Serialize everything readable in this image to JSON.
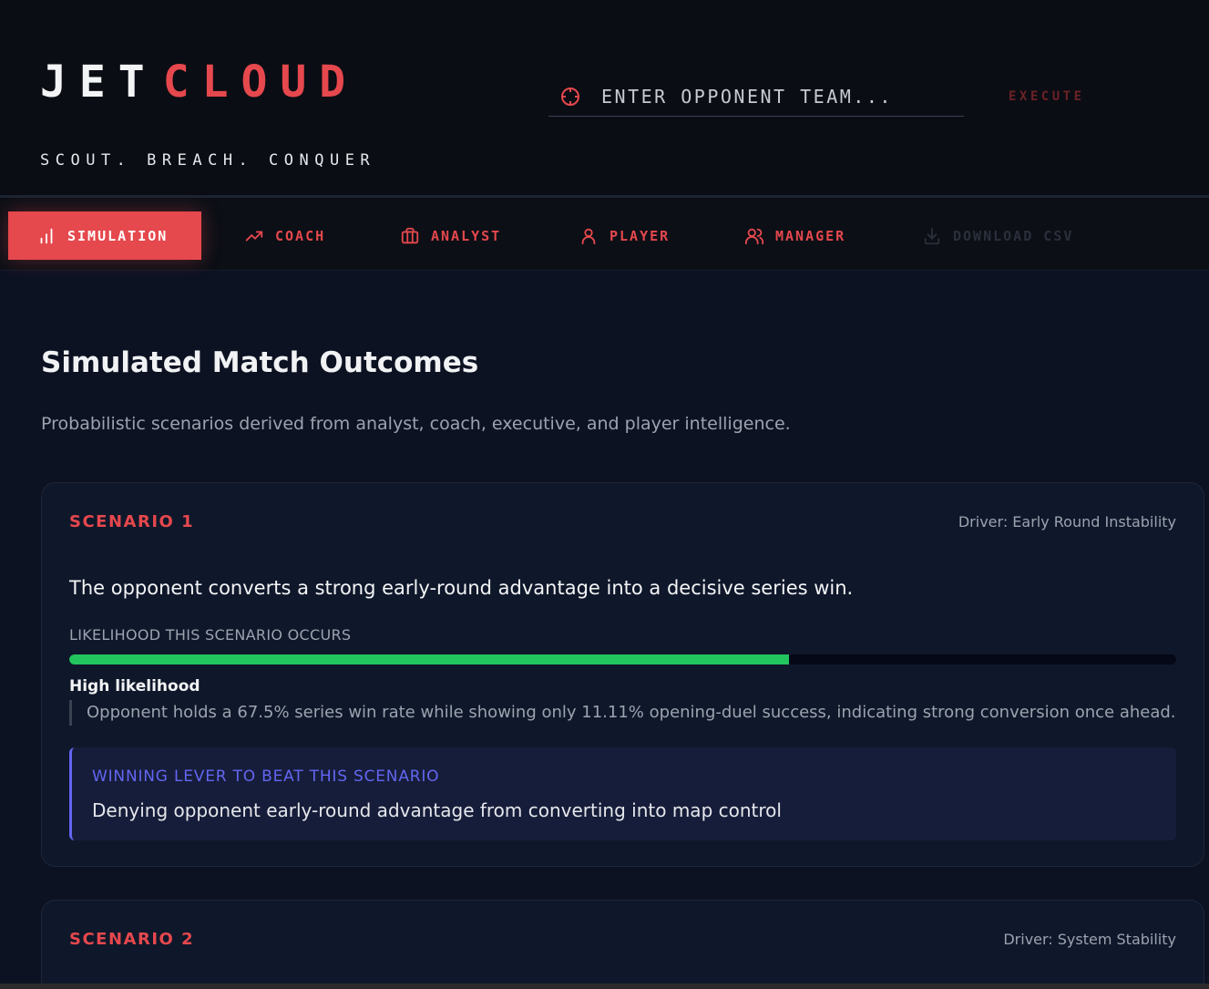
{
  "brand": {
    "word1": "JET",
    "word2": "CLOUD",
    "tagline": "SCOUT. BREACH. CONQUER"
  },
  "search": {
    "placeholder": "ENTER OPPONENT TEAM...",
    "execute_label": "EXECUTE"
  },
  "nav": {
    "tabs": [
      {
        "label": "SIMULATION",
        "icon": "bar-chart-icon",
        "active": true
      },
      {
        "label": "COACH",
        "icon": "trending-up-icon"
      },
      {
        "label": "ANALYST",
        "icon": "briefcase-icon"
      },
      {
        "label": "PLAYER",
        "icon": "user-icon"
      },
      {
        "label": "MANAGER",
        "icon": "users-icon"
      },
      {
        "label": "DOWNLOAD CSV",
        "icon": "download-icon",
        "disabled": true
      }
    ]
  },
  "main": {
    "title": "Simulated Match Outcomes",
    "subtitle": "Probabilistic scenarios derived from analyst, coach, executive, and player intelligence."
  },
  "scenarios": [
    {
      "label": "SCENARIO 1",
      "driver": "Driver: Early Round Instability",
      "outcome": "The opponent converts a strong early-round advantage into a decisive series win.",
      "likelihood_label": "LIKELIHOOD THIS SCENARIO OCCURS",
      "likelihood_fraction": 0.65,
      "likelihood_level": "High likelihood",
      "evidence": "Opponent holds a 67.5% series win rate while showing only 11.11% opening-duel success, indicating strong conversion once ahead.",
      "lever_title": "WINNING LEVER TO BEAT THIS SCENARIO",
      "lever_text": "Denying opponent early-round advantage from converting into map control"
    },
    {
      "label": "SCENARIO 2",
      "driver": "Driver: System Stability"
    }
  ],
  "colors": {
    "accent": "#e5484d",
    "success": "#22c55e",
    "lever": "#6366f1",
    "background": "#0c1222"
  }
}
